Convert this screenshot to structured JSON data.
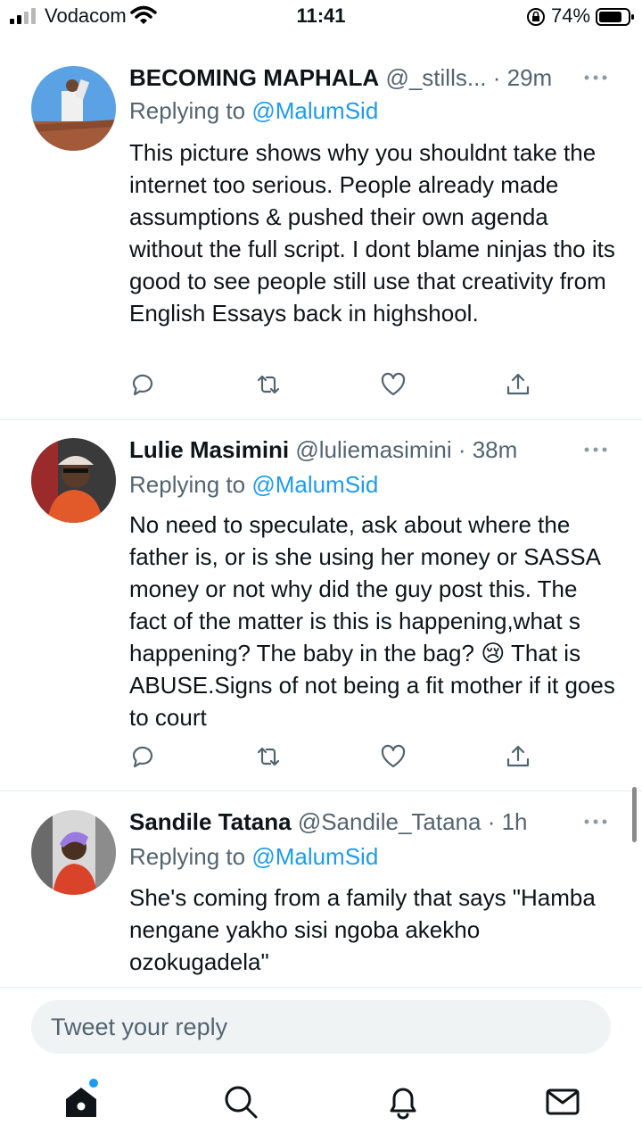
{
  "status_bar": {
    "carrier": "Vodacom",
    "time": "11:41",
    "battery_pct": "74%"
  },
  "tweets": [
    {
      "name": "BECOMING MAPHALA",
      "meta": "@_stills... · 29m",
      "replying_prefix": "Replying to",
      "replying_handle": "@MalumSid",
      "text": "This picture shows why you shouldnt take the internet too serious. People already made assumptions & pushed their own agenda without the full script. I dont blame ninjas tho its good to see people still use that creativity from English Essays back in highshool."
    },
    {
      "name": "Lulie Masimini",
      "meta": "@luliemasimini · 38m",
      "replying_prefix": "Replying to",
      "replying_handle": "@MalumSid",
      "text": "No need to speculate, ask about where the father is, or is she using her money or SASSA money or not why did the guy post this. The fact of the matter is this is happening,what s happening? The baby in the bag? 😢  That is ABUSE.Signs of not being a fit mother if it goes to court"
    },
    {
      "name": "Sandile Tatana",
      "meta": "@Sandile_Tatana · 1h",
      "replying_prefix": "Replying to",
      "replying_handle": "@MalumSid",
      "text": "She's coming from a family that says \"Hamba nengane yakho sisi ngoba akekho ozokugadela\""
    }
  ],
  "composer": {
    "placeholder": "Tweet your reply"
  },
  "icons": {
    "reply": "reply-icon",
    "retweet": "retweet-icon",
    "like": "heart-icon",
    "share": "share-icon",
    "home": "home-icon",
    "search": "search-icon",
    "notifications": "bell-icon",
    "messages": "mail-icon"
  },
  "colors": {
    "accent": "#1d9bf0",
    "text": "#0f1419",
    "muted": "#536471"
  }
}
